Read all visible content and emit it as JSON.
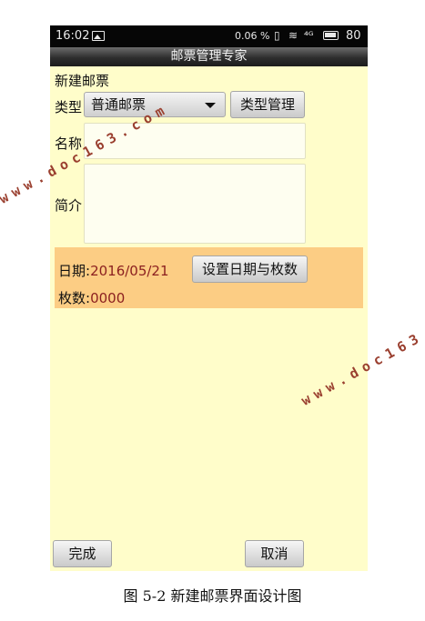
{
  "status": {
    "time": "16:02",
    "speed": "0.06 %",
    "signal": "⁴ᴳ",
    "battery": "80"
  },
  "app": {
    "title": "邮票管理专家"
  },
  "form": {
    "section_title": "新建邮票",
    "type_label": "类型",
    "type_selected": "普通邮票",
    "type_manage_button": "类型管理",
    "name_label": "名称",
    "intro_label": "简介"
  },
  "info_panel": {
    "date_label": "日期:",
    "date_value": "2016/05/21",
    "count_label": "枚数:",
    "count_value": "0000",
    "set_button": "设置日期与枚数"
  },
  "footer": {
    "done_button": "完成",
    "cancel_button": "取消"
  },
  "watermarks": [
    "www.doc163.com",
    "www.doc163.com"
  ],
  "caption": "图 5-2 新建邮票界面设计图",
  "colors": {
    "background": "#fffdca",
    "panel": "#fccd84",
    "value_text": "#8b1f1f",
    "titlebar": "#2e2e2e"
  }
}
